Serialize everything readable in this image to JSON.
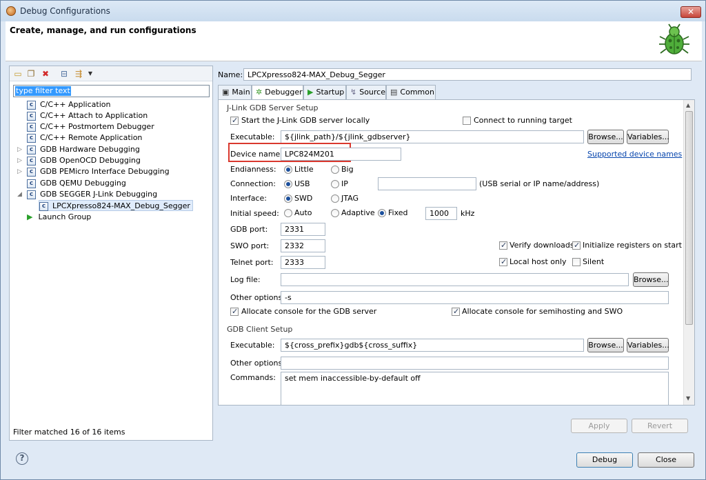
{
  "window": {
    "title": "Debug Configurations",
    "close_label": "✕"
  },
  "header": {
    "title": "Create, manage, and run configurations"
  },
  "left": {
    "filter_placeholder": "type filter text",
    "tree": [
      {
        "label": "C/C++ Application",
        "icon": "c-icon",
        "expandable": false
      },
      {
        "label": "C/C++ Attach to Application",
        "icon": "c-icon",
        "expandable": false
      },
      {
        "label": "C/C++ Postmortem Debugger",
        "icon": "c-icon",
        "expandable": false
      },
      {
        "label": "C/C++ Remote Application",
        "icon": "c-icon",
        "expandable": false
      },
      {
        "label": "GDB Hardware Debugging",
        "icon": "c-icon",
        "expandable": true,
        "expanded": false
      },
      {
        "label": "GDB OpenOCD Debugging",
        "icon": "c-icon",
        "expandable": true,
        "expanded": false
      },
      {
        "label": "GDB PEMicro Interface Debugging",
        "icon": "c-icon",
        "expandable": true,
        "expanded": false
      },
      {
        "label": "GDB QEMU Debugging",
        "icon": "c-icon",
        "expandable": false
      },
      {
        "label": "GDB SEGGER J-Link Debugging",
        "icon": "c-icon",
        "expandable": true,
        "expanded": true
      },
      {
        "label": "LPCXpresso824-MAX_Debug_Segger",
        "icon": "c-icon",
        "selected": true,
        "child": true
      },
      {
        "label": "Launch Group",
        "icon": "launch-icon",
        "expandable": false
      }
    ],
    "status": "Filter matched 16 of 16 items"
  },
  "right": {
    "name_label": "Name:",
    "name_value": "LPCXpresso824-MAX_Debug_Segger",
    "tabs": [
      {
        "label": "Main",
        "icon": "main-tab-icon",
        "glyph": "▣"
      },
      {
        "label": "Debugger",
        "icon": "debugger-tab-icon",
        "glyph": "✲"
      },
      {
        "label": "Startup",
        "icon": "startup-tab-icon",
        "glyph": "▶"
      },
      {
        "label": "Source",
        "icon": "source-tab-icon",
        "glyph": "↯"
      },
      {
        "label": "Common",
        "icon": "common-tab-icon",
        "glyph": "▤"
      }
    ],
    "active_tab": "Debugger",
    "server": {
      "group": "J-Link GDB Server Setup",
      "start_locally": "Start the J-Link GDB server locally",
      "connect_running": "Connect to running target",
      "executable_label": "Executable:",
      "executable_value": "${jlink_path}/${jlink_gdbserver}",
      "browse": "Browse...",
      "variables": "Variables...",
      "device_label": "Device name:",
      "device_value": "LPC824M201",
      "supported_link": "Supported device names",
      "endianness_label": "Endianness:",
      "little": "Little",
      "big": "Big",
      "connection_label": "Connection:",
      "usb": "USB",
      "ip": "IP",
      "ip_hint": "(USB serial or IP name/address)",
      "interface_label": "Interface:",
      "swd": "SWD",
      "jtag": "JTAG",
      "speed_label": "Initial speed:",
      "auto": "Auto",
      "adaptive": "Adaptive",
      "fixed": "Fixed",
      "speed_value": "1000",
      "khz": "kHz",
      "gdb_port_label": "GDB port:",
      "gdb_port": "2331",
      "swo_port_label": "SWO port:",
      "swo_port": "2332",
      "telnet_port_label": "Telnet port:",
      "telnet_port": "2333",
      "verify": "Verify downloads",
      "init_regs": "Initialize registers on start",
      "local_host": "Local host only",
      "silent": "Silent",
      "log_label": "Log file:",
      "other_label": "Other options:",
      "other_value": "-s",
      "alloc_console": "Allocate console for the GDB server",
      "alloc_semihost": "Allocate console for semihosting and SWO"
    },
    "client": {
      "group": "GDB Client Setup",
      "executable_label": "Executable:",
      "executable_value": "${cross_prefix}gdb${cross_suffix}",
      "browse": "Browse...",
      "variables": "Variables...",
      "other_label": "Other options:",
      "commands_label": "Commands:",
      "commands_value": "set mem inaccessible-by-default off"
    },
    "apply": "Apply",
    "revert": "Revert"
  },
  "footer": {
    "help": "?",
    "debug": "Debug",
    "close": "Close"
  }
}
